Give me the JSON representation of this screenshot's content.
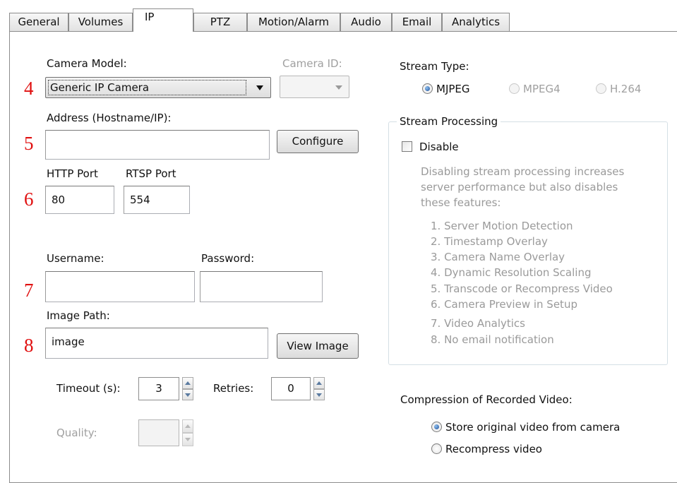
{
  "tabs": [
    {
      "label": "General",
      "active": false
    },
    {
      "label": "Volumes",
      "active": false
    },
    {
      "label": "IP",
      "active": true
    },
    {
      "label": "PTZ",
      "active": false
    },
    {
      "label": "Motion/Alarm",
      "active": false
    },
    {
      "label": "Audio",
      "active": false
    },
    {
      "label": "Email",
      "active": false
    },
    {
      "label": "Analytics",
      "active": false
    }
  ],
  "annotations": [
    "4",
    "5",
    "6",
    "7",
    "8"
  ],
  "camera": {
    "model_label": "Camera Model:",
    "model_value": "Generic IP Camera",
    "id_label": "Camera ID:",
    "id_value": ""
  },
  "address": {
    "label": "Address (Hostname/IP):",
    "value": "",
    "configure_button": "Configure"
  },
  "ports": {
    "http_label": "HTTP Port",
    "http_value": "80",
    "rtsp_label": "RTSP Port",
    "rtsp_value": "554"
  },
  "credentials": {
    "username_label": "Username:",
    "username_value": "",
    "password_label": "Password:",
    "password_value": ""
  },
  "image_path": {
    "label": "Image Path:",
    "value": "image",
    "view_button": "View Image"
  },
  "timeout": {
    "label": "Timeout (s):",
    "value": "3"
  },
  "retries": {
    "label": "Retries:",
    "value": "0"
  },
  "quality": {
    "label": "Quality:",
    "value": "",
    "enabled": false
  },
  "stream_type": {
    "label": "Stream Type:",
    "options": [
      {
        "label": "MJPEG",
        "selected": true,
        "enabled": true
      },
      {
        "label": "MPEG4",
        "selected": false,
        "enabled": false
      },
      {
        "label": "H.264",
        "selected": false,
        "enabled": false
      }
    ]
  },
  "stream_processing": {
    "title": "Stream Processing",
    "disable_label": "Disable",
    "disable_checked": false,
    "description": [
      "Disabling stream processing increases",
      "server performance but also disables",
      "these features:"
    ],
    "features": [
      "1. Server Motion Detection",
      "2. Timestamp Overlay",
      "3. Camera Name Overlay",
      "4. Dynamic Resolution Scaling",
      "5. Transcode or Recompress Video",
      "6. Camera Preview in Setup",
      "7. Video Analytics",
      "8. No email notification"
    ]
  },
  "compression": {
    "label": "Compression of Recorded Video:",
    "options": [
      {
        "label": "Store original video from camera",
        "selected": true
      },
      {
        "label": "Recompress video",
        "selected": false
      }
    ]
  },
  "colors": {
    "annotation": "#e01010",
    "radio_selected": "#1d4e9a",
    "disabled_text": "#a0a0a0",
    "group_border": "#d5dfe5"
  }
}
